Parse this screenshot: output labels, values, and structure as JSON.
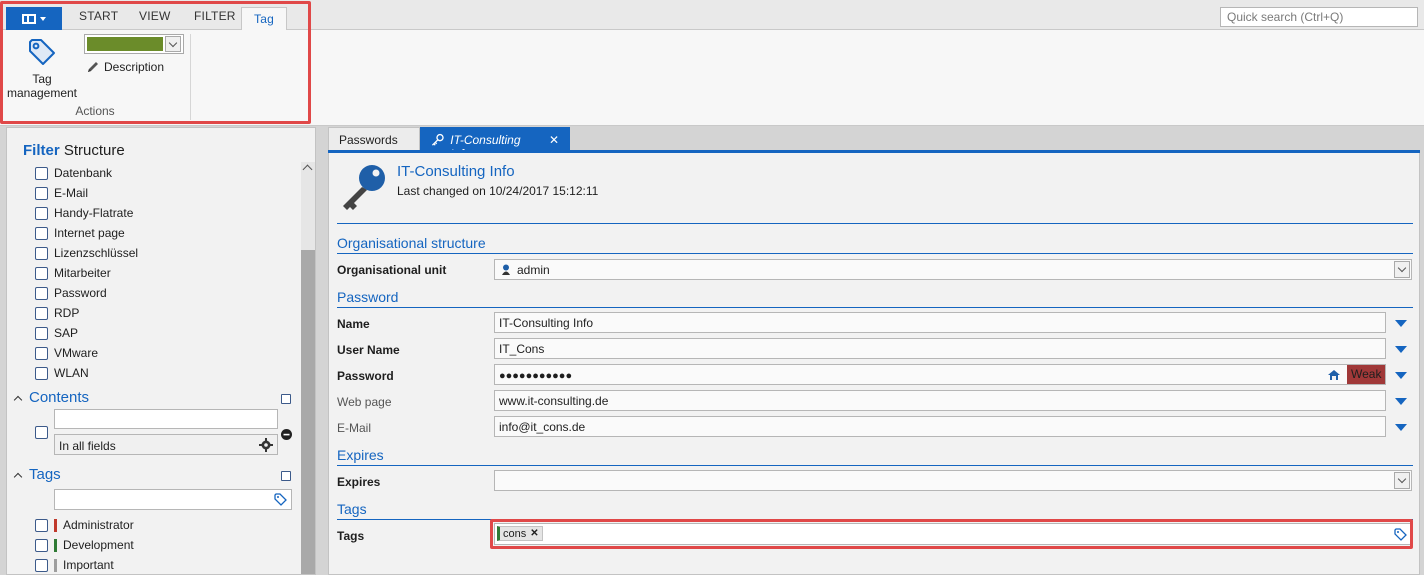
{
  "ribbon": {
    "tabs": [
      "START",
      "VIEW",
      "FILTER",
      "Tag"
    ],
    "active_tab": "Tag",
    "quick_search_placeholder": "Quick search (Ctrl+Q)",
    "tag_management_label": "Tag\nmanagement",
    "tag_management_line1": "Tag",
    "tag_management_line2": "management",
    "tag_color": "#6b8c2a",
    "description_label": "Description",
    "group_label": "Actions"
  },
  "filter": {
    "title_prefix": "Filter",
    "title_rest": "Structure",
    "structure_items": [
      "Datenbank",
      "E-Mail",
      "Handy-Flatrate",
      "Internet page",
      "Lizenzschlüssel",
      "Mitarbeiter",
      "Password",
      "RDP",
      "SAP",
      "VMware",
      "WLAN"
    ],
    "contents_header": "Contents",
    "contents_scope": "In all fields",
    "tags_header": "Tags",
    "tags": [
      {
        "label": "Administrator",
        "color": "#c0392b"
      },
      {
        "label": "Development",
        "color": "#2f7a35"
      },
      {
        "label": "Important",
        "color": "#9e9e9e"
      }
    ]
  },
  "document": {
    "tabs": [
      "Passwords",
      "IT-Consulting Info"
    ],
    "title": "IT-Consulting Info",
    "last_changed": "Last changed on 10/24/2017 15:12:11",
    "sections": {
      "org": "Organisational structure",
      "password": "Password",
      "expires": "Expires",
      "tags": "Tags"
    },
    "fields": {
      "org_unit_label": "Organisational unit",
      "org_unit_value": "admin",
      "name_label": "Name",
      "name_value": "IT-Consulting Info",
      "username_label": "User Name",
      "username_value": "IT_Cons",
      "password_label": "Password",
      "password_value": "●●●●●●●●●●●",
      "password_strength": "Weak",
      "webpage_label": "Web page",
      "webpage_value": "www.it-consulting.de",
      "email_label": "E-Mail",
      "email_value": "info@it_cons.de",
      "expires_label": "Expires",
      "expires_value": "",
      "tags_label": "Tags",
      "tag_chip": "cons"
    }
  }
}
